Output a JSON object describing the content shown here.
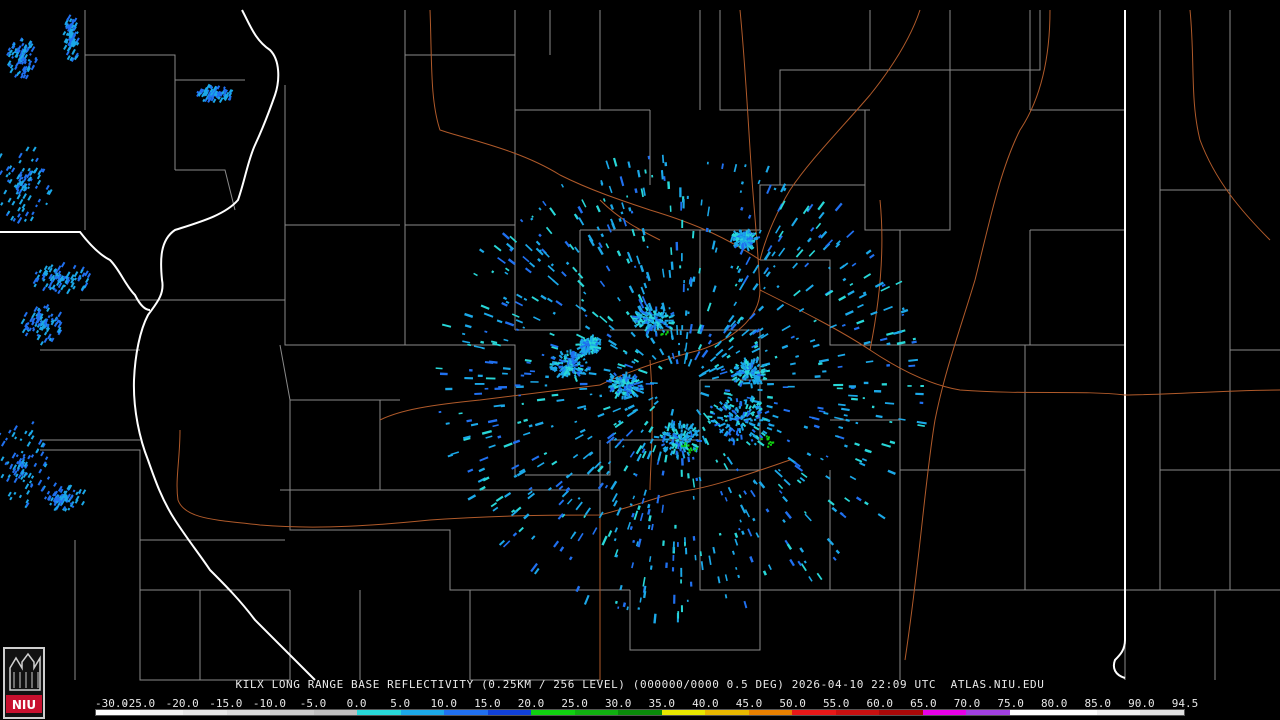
{
  "title": {
    "station": "KILX",
    "product": "LONG RANGE BASE REFLECTIVITY",
    "resolution": "(0.25KM / 256 LEVEL)",
    "volume": "(000000/0000 0.5 DEG)",
    "datetime": "2026-04-10 22:09 UTC",
    "site": "ATLAS.NIU.EDU"
  },
  "scale": {
    "labels": [
      "-30.0",
      "-25.0",
      "-20.0",
      "-15.0",
      "-10.0",
      "-5.0",
      "0.0",
      "5.0",
      "10.0",
      "15.0",
      "20.0",
      "25.0",
      "30.0",
      "35.0",
      "40.0",
      "45.0",
      "50.0",
      "55.0",
      "60.0",
      "65.0",
      "70.0",
      "75.0",
      "80.0",
      "85.0",
      "90.0",
      "94.5"
    ],
    "colors": [
      "#ffffff",
      "#f2f2f2",
      "#e6e6e6",
      "#dadada",
      "#cccccc",
      "#bfbfbf",
      "#28d8d8",
      "#1ba8e8",
      "#2070f0",
      "#1040d8",
      "#10d010",
      "#10b010",
      "#0a8a0a",
      "#e8e800",
      "#e8b800",
      "#e88000",
      "#e81818",
      "#c81010",
      "#a80808",
      "#e800e8",
      "#a040e0",
      "#ffffff",
      "#ffffff",
      "#f0f0f0",
      "#e0e0e0"
    ]
  },
  "logo": {
    "text": "NIU"
  },
  "colors": {
    "county": "#8a8a8a",
    "state": "#ffffff",
    "road": "#b05a2a",
    "echo_light": "#1ba8e8",
    "echo_medium": "#2070f0",
    "echo_teal": "#28d8d8",
    "echo_green": "#10d010"
  }
}
